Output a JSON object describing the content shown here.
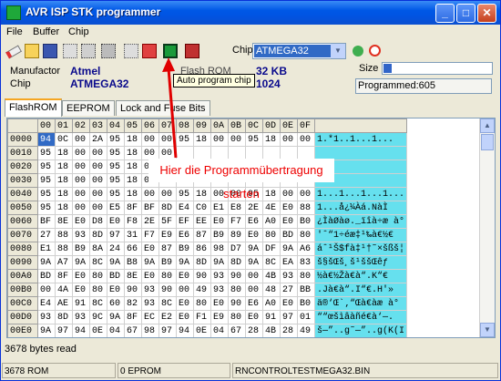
{
  "window": {
    "title": "AVR ISP STK programmer"
  },
  "menu": [
    "File",
    "Buffer",
    "Chip"
  ],
  "toolbar": {
    "chip_label": "Chip",
    "chip_value": "ATMEGA32",
    "tooltip": "Auto program chip"
  },
  "info": {
    "manufactor_label": "Manufactor",
    "manufactor_value": "Atmel",
    "chip_label": "Chip",
    "chip_value": "ATMEGA32",
    "flash_label": "Flash ROM",
    "flash_value": "32 KB",
    "eeprom_label": "EEPROM",
    "eeprom_value": "1024",
    "size_label": "Size",
    "programmed": "Programmed:605"
  },
  "tabs": [
    "FlashROM",
    "EEPROM",
    "Lock and Fuse Bits"
  ],
  "grid": {
    "columns": [
      "00",
      "01",
      "02",
      "03",
      "04",
      "05",
      "06",
      "07",
      "08",
      "09",
      "0A",
      "0B",
      "0C",
      "0D",
      "0E",
      "0F"
    ],
    "rows": [
      {
        "addr": "0000",
        "bytes": [
          "94",
          "0C",
          "00",
          "2A",
          "95",
          "18",
          "00",
          "00",
          "95",
          "18",
          "00",
          "00",
          "95",
          "18",
          "00",
          "00"
        ],
        "ascii": "1.*1..1...1..."
      },
      {
        "addr": "0010",
        "bytes": [
          "95",
          "18",
          "00",
          "00",
          "95",
          "18",
          "00",
          "00",
          "",
          "",
          "",
          "",
          "",
          "",
          "",
          ""
        ],
        "ascii": ""
      },
      {
        "addr": "0020",
        "bytes": [
          "95",
          "18",
          "00",
          "00",
          "95",
          "18",
          "00",
          "00",
          "",
          "",
          "",
          "",
          "",
          "",
          "",
          ""
        ],
        "ascii": ""
      },
      {
        "addr": "0030",
        "bytes": [
          "95",
          "18",
          "00",
          "00",
          "95",
          "18",
          "00",
          "00",
          "",
          "",
          "",
          "",
          "",
          "",
          "",
          ""
        ],
        "ascii": ""
      },
      {
        "addr": "0040",
        "bytes": [
          "95",
          "18",
          "00",
          "00",
          "95",
          "18",
          "00",
          "00",
          "95",
          "18",
          "00",
          "00",
          "95",
          "18",
          "00",
          "00"
        ],
        "ascii": "1...1...1...1..."
      },
      {
        "addr": "0050",
        "bytes": [
          "95",
          "18",
          "00",
          "00",
          "E5",
          "8F",
          "BF",
          "8D",
          "E4",
          "C0",
          "E1",
          "E8",
          "2E",
          "4E",
          "E0",
          "88"
        ],
        "ascii": "1...å¿¼Àá.NàÌ"
      },
      {
        "addr": "0060",
        "bytes": [
          "BF",
          "8E",
          "E0",
          "D8",
          "E0",
          "F8",
          "2E",
          "5F",
          "EF",
          "EE",
          "E0",
          "F7",
          "E6",
          "A0",
          "E0",
          "B0"
        ],
        "ascii": "¿ÌàØàø._ïîà÷æ à°"
      },
      {
        "addr": "0070",
        "bytes": [
          "27",
          "88",
          "93",
          "8D",
          "97",
          "31",
          "F7",
          "E9",
          "E6",
          "87",
          "B9",
          "89",
          "E0",
          "80",
          "BD",
          "80"
        ],
        "ascii": "'ˆ“1÷éæ‡¹‰à€½€"
      },
      {
        "addr": "0080",
        "bytes": [
          "E1",
          "88",
          "B9",
          "8A",
          "24",
          "66",
          "E0",
          "87",
          "B9",
          "86",
          "98",
          "D7",
          "9A",
          "DF",
          "9A",
          "A6"
        ],
        "ascii": "áˆ¹Š$fà‡¹†˜×šßš¦"
      },
      {
        "addr": "0090",
        "bytes": [
          "9A",
          "A7",
          "9A",
          "8C",
          "9A",
          "B8",
          "9A",
          "B9",
          "9A",
          "8D",
          "9A",
          "8D",
          "9A",
          "8C",
          "EA",
          "83"
        ],
        "ascii": "š§šŒš¸š¹ššŒêƒ"
      },
      {
        "addr": "00A0",
        "bytes": [
          "BD",
          "8F",
          "E0",
          "80",
          "BD",
          "8E",
          "E0",
          "80",
          "E0",
          "90",
          "93",
          "90",
          "00",
          "4B",
          "93",
          "80"
        ],
        "ascii": "½à€½Žà€à“.K“€"
      },
      {
        "addr": "00B0",
        "bytes": [
          "00",
          "4A",
          "E0",
          "80",
          "E0",
          "90",
          "93",
          "90",
          "00",
          "49",
          "93",
          "80",
          "00",
          "48",
          "27",
          "BB"
        ],
        "ascii": ".Jà€à“.I“€.H'»"
      },
      {
        "addr": "00C0",
        "bytes": [
          "E4",
          "AE",
          "91",
          "8C",
          "60",
          "82",
          "93",
          "8C",
          "E0",
          "80",
          "E0",
          "90",
          "E6",
          "A0",
          "E0",
          "B0"
        ],
        "ascii": "ä®‘Œ`‚“Œà€àæ à°"
      },
      {
        "addr": "00D0",
        "bytes": [
          "93",
          "8D",
          "93",
          "9C",
          "9A",
          "8F",
          "EC",
          "E2",
          "E0",
          "F1",
          "E9",
          "80",
          "E0",
          "91",
          "97",
          "01"
        ],
        "ascii": "““œšìâàñé€à‘—."
      },
      {
        "addr": "00E0",
        "bytes": [
          "9A",
          "97",
          "94",
          "0E",
          "04",
          "67",
          "98",
          "97",
          "94",
          "0E",
          "04",
          "67",
          "28",
          "4B",
          "28",
          "49"
        ],
        "ascii": "š—”..g˜—”..g(K(I"
      }
    ]
  },
  "annotation": "Hier die Programmübertragung starten",
  "status": {
    "bytes_read": "3678 bytes read",
    "rom": "3678 ROM",
    "eprom": "0 EPROM",
    "file": "RNCONTROLTESTMEGA32.BIN"
  },
  "colors": {
    "title_bar": "#0054e3",
    "ascii_bg": "#66e0ee",
    "selected": "#316ac5",
    "annotation_red": "#e00000",
    "value_blue": "#0a0a8c"
  },
  "progress": {
    "size_fraction": 0.04
  }
}
